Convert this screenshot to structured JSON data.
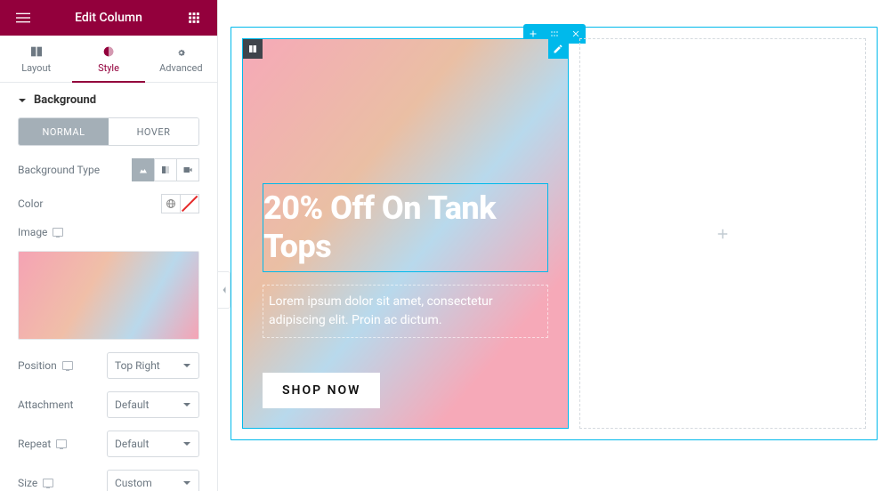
{
  "header": {
    "title": "Edit Column"
  },
  "tabs": {
    "layout": "Layout",
    "style": "Style",
    "advanced": "Advanced"
  },
  "section": {
    "title": "Background",
    "state_normal": "NORMAL",
    "state_hover": "HOVER",
    "bg_type_label": "Background Type",
    "color_label": "Color",
    "image_label": "Image",
    "position": {
      "label": "Position",
      "value": "Top Right"
    },
    "attachment": {
      "label": "Attachment",
      "value": "Default"
    },
    "repeat": {
      "label": "Repeat",
      "value": "Default"
    },
    "size": {
      "label": "Size",
      "value": "Custom"
    }
  },
  "canvas": {
    "heading": "20% Off On Tank Tops",
    "lorem": "Lorem ipsum dolor sit amet, consectetur adipiscing elit. Proin ac dictum.",
    "button": "SHOP NOW"
  },
  "colors": {
    "brand": "#93003c",
    "accent": "#00b9eb"
  }
}
